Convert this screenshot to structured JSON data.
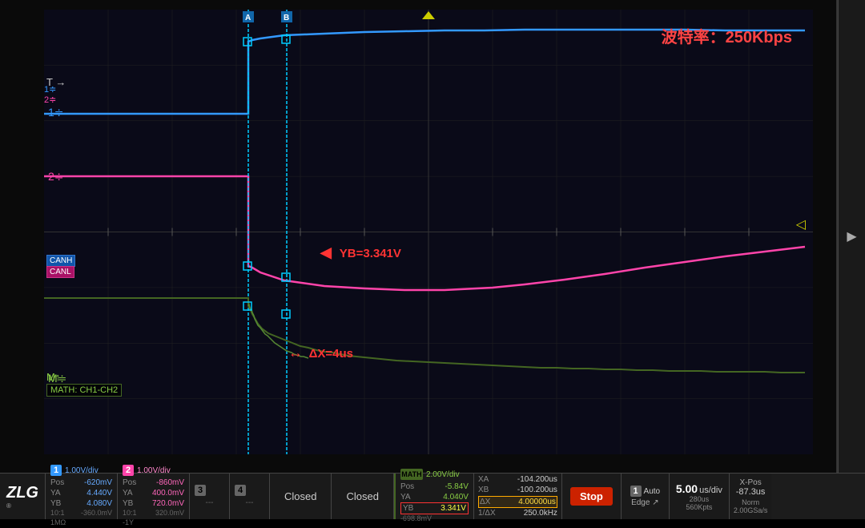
{
  "title": "波特率：250Kbps",
  "screen": {
    "grid_cols": 12,
    "grid_rows": 8,
    "bg_color": "#0a0a14"
  },
  "annotations": {
    "yb_label": "YB=3.341V",
    "dx_label": "ΔX=4us"
  },
  "cursor": {
    "a_label": "A",
    "b_label": "B"
  },
  "channel_labels": {
    "canh": "CANH",
    "canl": "CANL",
    "ch1_label": "1",
    "ch2_label": "2",
    "math_label": "MATH: CH1-CH2"
  },
  "bottom_bar": {
    "ch1": {
      "num": "1",
      "vdiv": "1.00V/div",
      "pos_label": "Pos",
      "pos_val": "-620mV",
      "ya_label": "YA",
      "ya_val": "4.440V",
      "yb_label": "YB",
      "yb_val": "4.080V",
      "extra": "101\n1MΩ",
      "extra2": "-360.0mV"
    },
    "ch2": {
      "num": "2",
      "vdiv": "1.00V/div",
      "pos_label": "Pos",
      "pos_val": "-860mV",
      "ya_label": "YA",
      "ya_val": "400.0mV",
      "yb_label": "YB",
      "yb_val": "720.0mV",
      "extra": "101",
      "extra2": "320.0mV",
      "extra3": "-1Y"
    },
    "ch3": {
      "label": "3",
      "content": "---"
    },
    "ch4": {
      "label": "4",
      "content": "---"
    },
    "closed1": "Closed",
    "closed2": "Closed",
    "math": {
      "label": "MATH",
      "vdiv": "2.00V/div",
      "pos_label": "Pos",
      "pos_val": "-5.84V",
      "ya_label": "YA",
      "ya_val": "4.040V",
      "yb_label": "YB",
      "yb_val": "3.341V",
      "extra": "-698.8mV"
    },
    "meas": {
      "xa_label": "XA",
      "xa_val": "-104.200us",
      "xb_label": "XB",
      "xb_val": "-100.200us",
      "dx_label": "ΔX",
      "dx_val": "4.00000us",
      "freq_label": "1/ΔX",
      "freq_val": "250.0kHz"
    },
    "stop_btn": "Stop",
    "trigger": {
      "num1": "1",
      "mode": "Auto",
      "type": "Edge",
      "slope": "↗"
    },
    "tdiv": {
      "main": "5.00",
      "unit": "us/div",
      "pts": "280us",
      "pts2": "560Kpts"
    },
    "xpos": {
      "label": "X-Pos",
      "val": "-87.3us"
    },
    "norm": {
      "label": "Norm",
      "val": "2.00GSa/s"
    }
  },
  "t_arrow": "T →",
  "m_ground": "M↑",
  "trigger_top": "▽",
  "trigger_right": "◁"
}
